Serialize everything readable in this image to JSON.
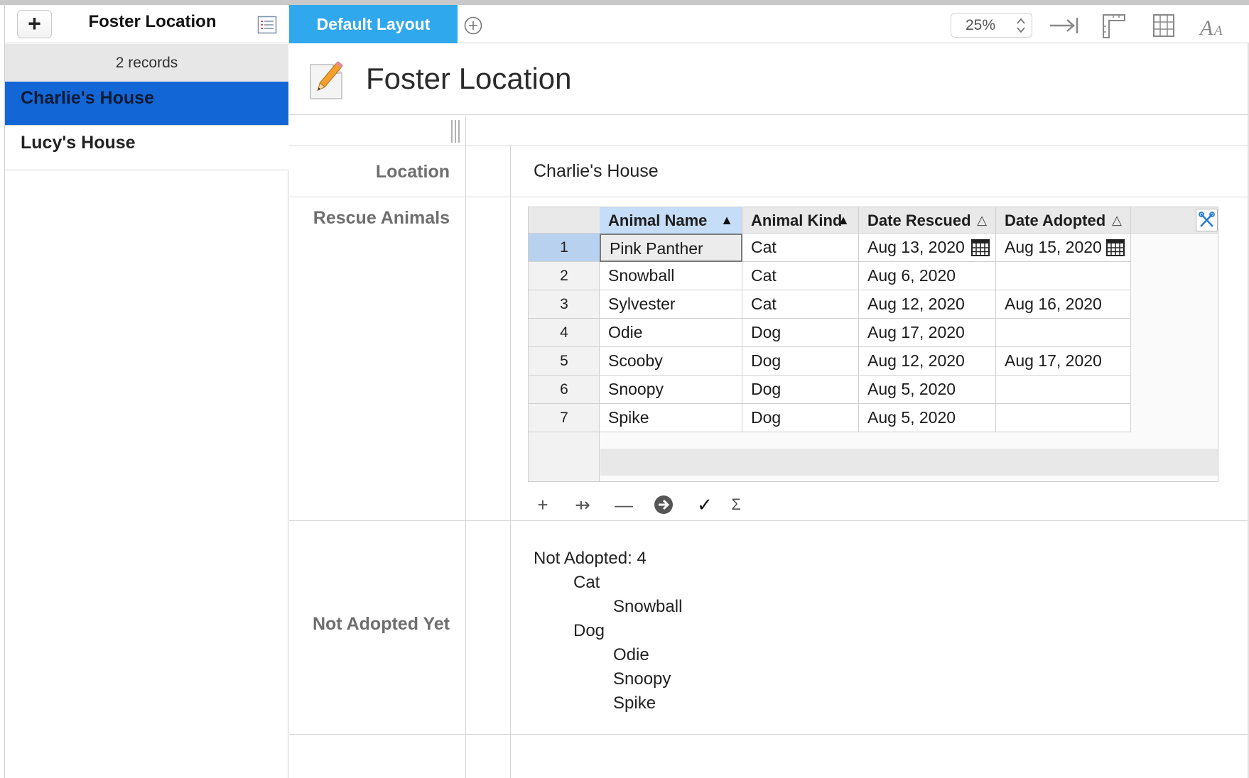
{
  "sidebar": {
    "add_label": "+",
    "title": "Foster Location",
    "records_count": "2 records",
    "records": [
      {
        "label": "Charlie's House",
        "selected": true
      },
      {
        "label": "Lucy's House",
        "selected": false
      }
    ]
  },
  "toolbar": {
    "layout_tab": "Default Layout",
    "zoom": "25%",
    "icons": [
      "add-layout-icon",
      "tab-to-end-icon",
      "ruler-icon",
      "grid-icon",
      "font-icon"
    ]
  },
  "form": {
    "title": "Foster Location",
    "fields": {
      "location_label": "Location",
      "location_value": "Charlie's House",
      "rescue_label": "Rescue Animals",
      "notadopted_label": "Not Adopted Yet"
    },
    "grid": {
      "columns": [
        {
          "label": "Animal Name",
          "sort": "▲"
        },
        {
          "label": "Animal Kind",
          "sort": "▲"
        },
        {
          "label": "Date Rescued",
          "sort": "△"
        },
        {
          "label": "Date Adopted",
          "sort": "△"
        }
      ],
      "rows": [
        {
          "num": "1",
          "name": "Pink Panther",
          "kind": "Cat",
          "rescued": "Aug 13, 2020",
          "adopted": "Aug 15, 2020"
        },
        {
          "num": "2",
          "name": "Snowball",
          "kind": "Cat",
          "rescued": "Aug 6, 2020",
          "adopted": ""
        },
        {
          "num": "3",
          "name": "Sylvester",
          "kind": "Cat",
          "rescued": "Aug 12, 2020",
          "adopted": "Aug 16, 2020"
        },
        {
          "num": "4",
          "name": "Odie",
          "kind": "Dog",
          "rescued": "Aug 17, 2020",
          "adopted": ""
        },
        {
          "num": "5",
          "name": "Scooby",
          "kind": "Dog",
          "rescued": "Aug 12, 2020",
          "adopted": "Aug 17, 2020"
        },
        {
          "num": "6",
          "name": "Snoopy",
          "kind": "Dog",
          "rescued": "Aug 5, 2020",
          "adopted": ""
        },
        {
          "num": "7",
          "name": "Spike",
          "kind": "Dog",
          "rescued": "Aug 5, 2020",
          "adopted": ""
        }
      ],
      "tools": {
        "add": "+",
        "insert": "⇸",
        "remove": "—",
        "go": "➔",
        "check": "✓",
        "sum": "Σ"
      }
    },
    "summary": {
      "heading": "Not Adopted: 4",
      "groups": [
        {
          "kind": "Cat",
          "animals": [
            "Snowball"
          ]
        },
        {
          "kind": "Dog",
          "animals": [
            "Odie",
            "Snoopy",
            "Spike"
          ]
        }
      ]
    }
  },
  "colors": {
    "selected_record": "#1366d6",
    "layout_tab": "#30a8ee",
    "active_header": "#c6ddf7"
  }
}
